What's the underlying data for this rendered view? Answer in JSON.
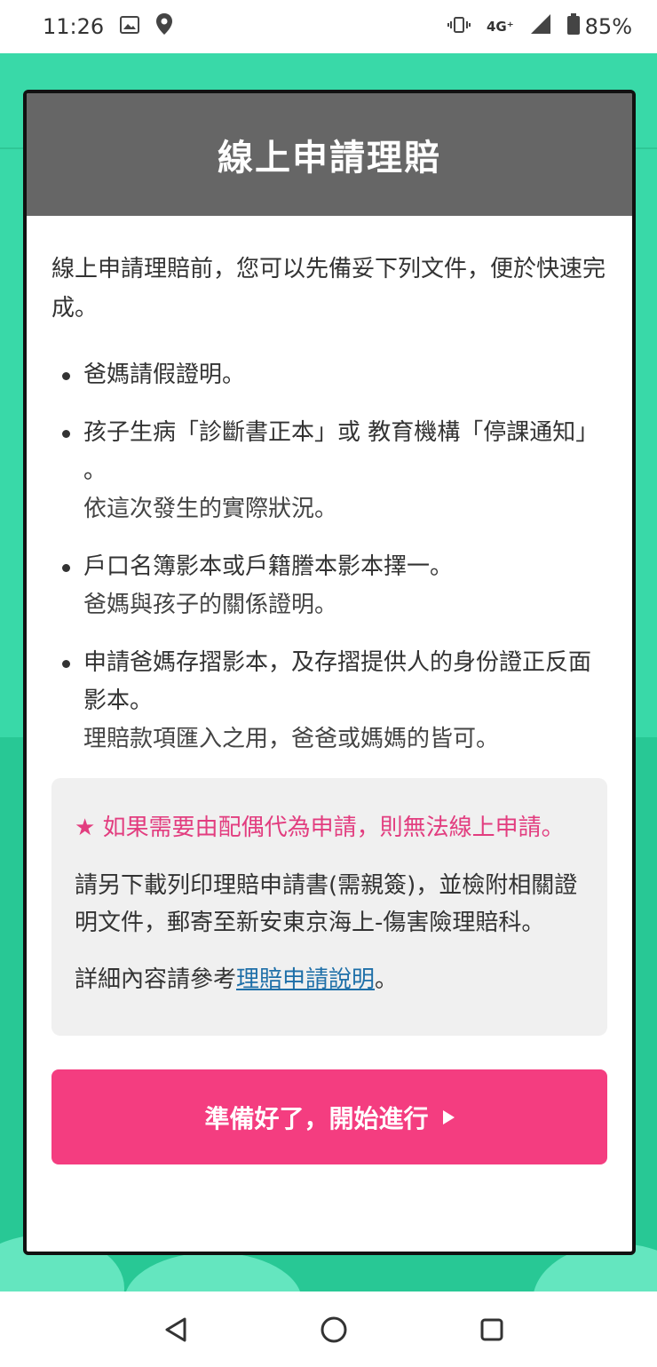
{
  "status_bar": {
    "time": "11:26",
    "network": "4G⁺",
    "battery": "85%"
  },
  "modal": {
    "title": "線上申請理賠",
    "intro": "線上申請理賠前，您可以先備妥下列文件，便於快速完成。",
    "items": [
      {
        "main": "爸媽請假證明。",
        "sub": ""
      },
      {
        "main": "孩子生病「診斷書正本」或 教育機構「停課通知」 。",
        "sub": "依這次發生的實際狀況。"
      },
      {
        "main": "戶口名簿影本或戶籍謄本影本擇一。",
        "sub": "爸媽與孩子的關係證明。"
      },
      {
        "main": "申請爸媽存摺影本，及存摺提供人的身份證正反面影本。",
        "sub": "理賠款項匯入之用，爸爸或媽媽的皆可。"
      }
    ],
    "notice": {
      "warning": "★ 如果需要由配偶代為申請，則無法線上申請。",
      "instruction": "請另下載列印理賠申請書(需親簽)，並檢附相關證明文件，郵寄至新安東京海上-傷害險理賠科。",
      "detail_prefix": "詳細內容請參考",
      "detail_link": "理賠申請說明",
      "detail_suffix": "。"
    },
    "cta_label": "準備好了，開始進行"
  },
  "colors": {
    "header": "#666666",
    "accent_pink": "#f43d80",
    "warning_pink": "#e23d7f",
    "link": "#1e6fa8",
    "background_green": "#39d9a8"
  },
  "icons": {
    "status_left": [
      "image-icon",
      "location-icon"
    ],
    "status_right": [
      "vibrate-icon",
      "signal-icon",
      "battery-icon"
    ],
    "nav": [
      "back-icon",
      "home-icon",
      "recents-icon"
    ]
  }
}
